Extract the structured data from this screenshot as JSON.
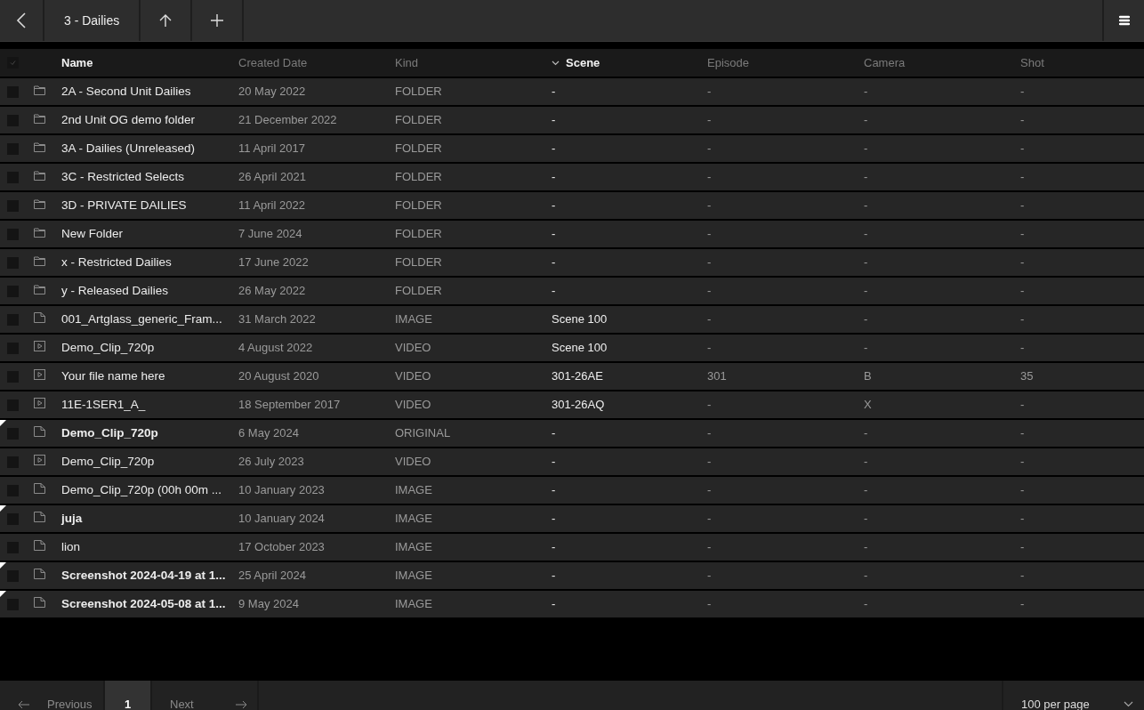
{
  "toolbar": {
    "title": "3 - Dailies"
  },
  "table": {
    "columns": [
      {
        "label": "Name",
        "sorted": false,
        "emphasis": true
      },
      {
        "label": "Created Date",
        "sorted": false,
        "emphasis": false
      },
      {
        "label": "Kind",
        "sorted": false,
        "emphasis": false
      },
      {
        "label": "Scene",
        "sorted": true,
        "emphasis": true
      },
      {
        "label": "Episode",
        "sorted": false,
        "emphasis": false
      },
      {
        "label": "Camera",
        "sorted": false,
        "emphasis": false
      },
      {
        "label": "Shot",
        "sorted": false,
        "emphasis": false
      }
    ],
    "select_all": {
      "checked": false
    },
    "rows": [
      {
        "kind": "folder",
        "unread": false,
        "checked": false,
        "cells": [
          "2A - Second Unit Dailies",
          "20 May 2022",
          "FOLDER",
          "-",
          "-",
          "-",
          "-"
        ]
      },
      {
        "kind": "folder",
        "unread": false,
        "checked": false,
        "cells": [
          "2nd Unit OG demo folder",
          "21 December 2022",
          "FOLDER",
          "-",
          "-",
          "-",
          "-"
        ]
      },
      {
        "kind": "folder",
        "unread": false,
        "checked": false,
        "cells": [
          "3A - Dailies (Unreleased)",
          "11 April 2017",
          "FOLDER",
          "-",
          "-",
          "-",
          "-"
        ]
      },
      {
        "kind": "folder",
        "unread": false,
        "checked": false,
        "cells": [
          "3C - Restricted Selects",
          "26 April 2021",
          "FOLDER",
          "-",
          "-",
          "-",
          "-"
        ]
      },
      {
        "kind": "folder",
        "unread": false,
        "checked": false,
        "cells": [
          "3D - PRIVATE DAILIES",
          "11 April 2022",
          "FOLDER",
          "-",
          "-",
          "-",
          "-"
        ]
      },
      {
        "kind": "folder",
        "unread": false,
        "checked": false,
        "cells": [
          "New Folder",
          "7 June 2024",
          "FOLDER",
          "-",
          "-",
          "-",
          "-"
        ]
      },
      {
        "kind": "folder",
        "unread": false,
        "checked": false,
        "cells": [
          "x - Restricted Dailies",
          "17 June 2022",
          "FOLDER",
          "-",
          "-",
          "-",
          "-"
        ]
      },
      {
        "kind": "folder",
        "unread": false,
        "checked": false,
        "cells": [
          "y - Released Dailies",
          "26 May 2022",
          "FOLDER",
          "-",
          "-",
          "-",
          "-"
        ]
      },
      {
        "kind": "file",
        "unread": false,
        "checked": false,
        "cells": [
          "001_Artglass_generic_Fram...",
          "31 March 2022",
          "IMAGE",
          "Scene 100",
          "-",
          "-",
          "-"
        ]
      },
      {
        "kind": "video",
        "unread": false,
        "checked": false,
        "cells": [
          "Demo_Clip_720p",
          "4 August 2022",
          "VIDEO",
          "Scene 100",
          "-",
          "-",
          "-"
        ]
      },
      {
        "kind": "video",
        "unread": false,
        "checked": false,
        "cells": [
          "Your file name here",
          "20 August 2020",
          "VIDEO",
          "301-26AE",
          "301",
          "B",
          "35"
        ]
      },
      {
        "kind": "video",
        "unread": false,
        "checked": false,
        "cells": [
          "11E-1SER1_A_",
          "18 September 2017",
          "VIDEO",
          "301-26AQ",
          "-",
          "X",
          "-"
        ]
      },
      {
        "kind": "file",
        "unread": true,
        "checked": false,
        "cells": [
          "Demo_Clip_720p",
          "6 May 2024",
          "ORIGINAL",
          "-",
          "-",
          "-",
          "-"
        ]
      },
      {
        "kind": "video",
        "unread": false,
        "checked": false,
        "cells": [
          "Demo_Clip_720p",
          "26 July 2023",
          "VIDEO",
          "-",
          "-",
          "-",
          "-"
        ]
      },
      {
        "kind": "file",
        "unread": false,
        "checked": false,
        "cells": [
          "Demo_Clip_720p (00h 00m ...",
          "10 January 2023",
          "IMAGE",
          "-",
          "-",
          "-",
          "-"
        ]
      },
      {
        "kind": "file",
        "unread": true,
        "checked": false,
        "cells": [
          "juja",
          "10 January 2024",
          "IMAGE",
          "-",
          "-",
          "-",
          "-"
        ]
      },
      {
        "kind": "file",
        "unread": false,
        "checked": false,
        "cells": [
          "lion",
          "17 October 2023",
          "IMAGE",
          "-",
          "-",
          "-",
          "-"
        ]
      },
      {
        "kind": "file",
        "unread": true,
        "checked": false,
        "cells": [
          "Screenshot 2024-04-19 at 1...",
          "25 April 2024",
          "IMAGE",
          "-",
          "-",
          "-",
          "-"
        ]
      },
      {
        "kind": "file",
        "unread": true,
        "checked": false,
        "cells": [
          "Screenshot 2024-05-08 at 1...",
          "9 May 2024",
          "IMAGE",
          "-",
          "-",
          "-",
          "-"
        ]
      }
    ]
  },
  "pagination": {
    "previous": "Previous",
    "pages": [
      {
        "label": "1",
        "selected": true
      }
    ],
    "next": "Next",
    "page_size": "100 per page"
  }
}
